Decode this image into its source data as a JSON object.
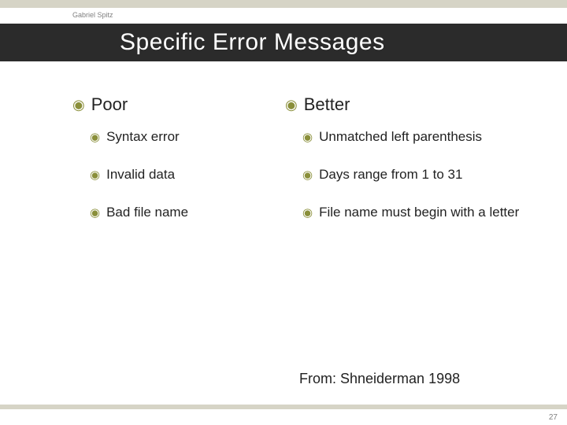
{
  "author": "Gabriel Spitz",
  "title": "Specific Error Messages",
  "columns": {
    "left": {
      "heading": "Poor",
      "items": [
        "Syntax error",
        "Invalid data",
        "Bad file name"
      ]
    },
    "right": {
      "heading": "Better",
      "items": [
        "Unmatched left parenthesis",
        "Days range from 1 to 31",
        "File name must begin with a letter"
      ]
    }
  },
  "citation": "From: Shneiderman 1998",
  "page_number": "27",
  "bullet_glyph": "◉"
}
